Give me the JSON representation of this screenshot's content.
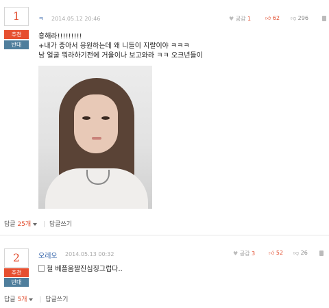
{
  "comments": [
    {
      "rank": "1",
      "recommend_label": "추천",
      "oppose_label": "반대",
      "author": "ㅋ",
      "date": "2014.05.12 20:46",
      "empathy_label": "공감",
      "empathy_count": "1",
      "likes": "62",
      "dislikes": "296",
      "lines": [
        "흥해라!!!!!!!!!",
        "+내가 좋아서 응원하는데 왜 니들이 지랄이야 ㅋㅋㅋ",
        "남 얼굴 뭐라하기전에 거울이나 보고와라 ㅋㅋ 오크년들이"
      ],
      "reply_label": "답글",
      "reply_count": "25개",
      "write_reply_label": "답글쓰기"
    },
    {
      "rank": "2",
      "recommend_label": "추천",
      "oppose_label": "반대",
      "author": "오레오",
      "date": "2014.05.13 00:32",
      "empathy_label": "공감",
      "empathy_count": "3",
      "likes": "52",
      "dislikes": "26",
      "lines": [
        "철 베플움짤진심징그럽다.."
      ],
      "reply_label": "답글",
      "reply_count": "5개",
      "write_reply_label": "답글쓰기"
    }
  ],
  "colors": {
    "accent_red": "#e14a2b",
    "recommend_bg": "#e64f30",
    "oppose_bg": "#4f7e9c",
    "author_blue": "#2d5fa8"
  }
}
